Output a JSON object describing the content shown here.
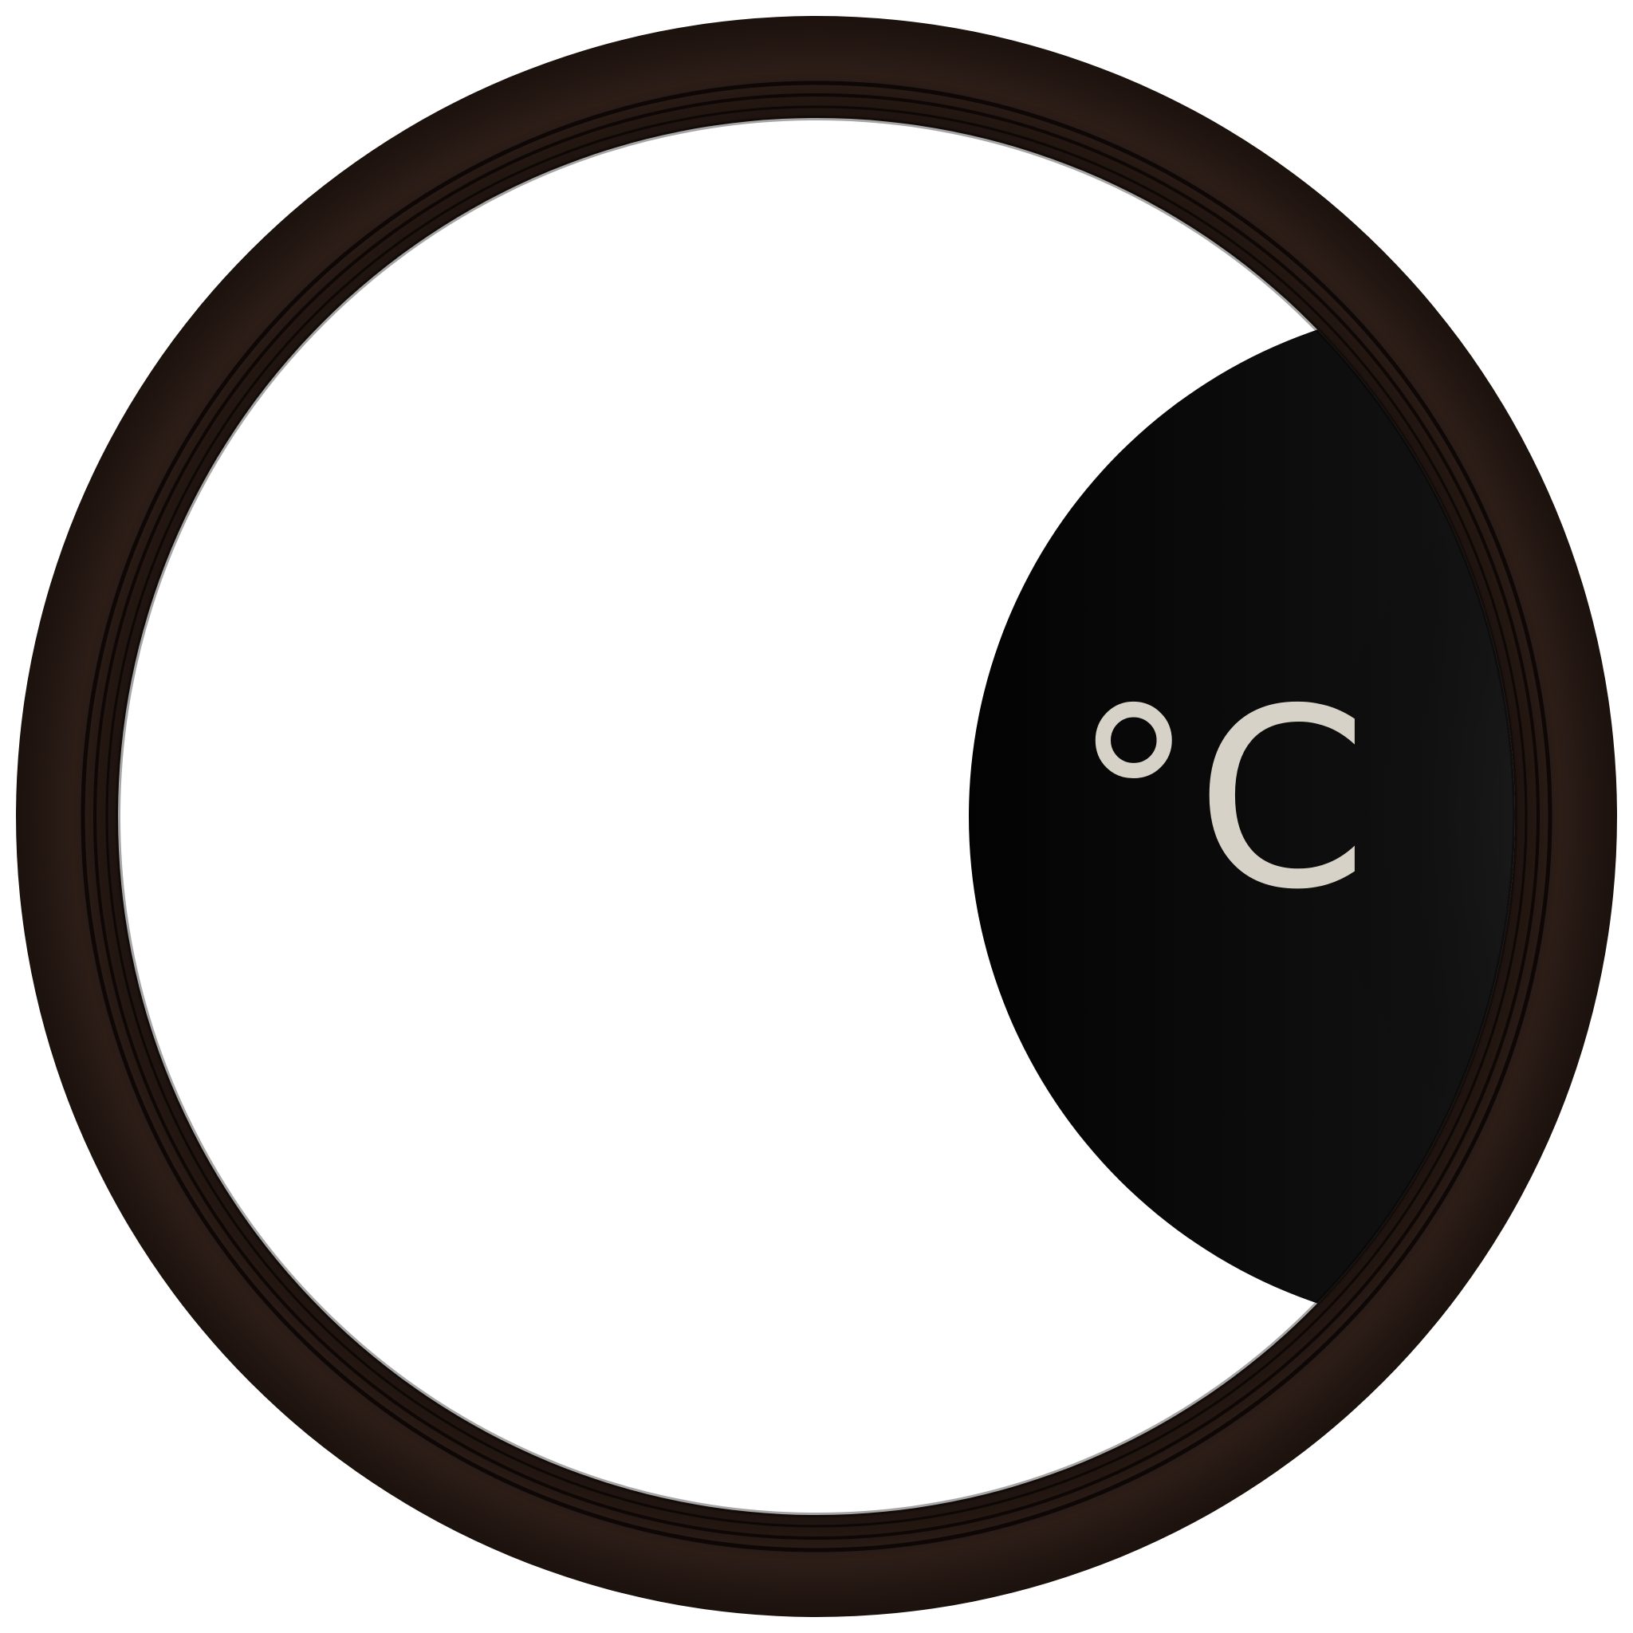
{
  "gauge": {
    "unit_label": "°C",
    "colors": {
      "background": "#ffffff",
      "bezel_outer": "#2a1c16",
      "bezel_inner": "#1f1410",
      "bezel_groove": "#120b08",
      "face": "#ffffff",
      "knob_dark": "#050505",
      "knob_mid": "#1a1a1a",
      "knob_light": "#2e2e2e",
      "unit_text": "#d6d2c8"
    },
    "icons": {
      "bezel": "round-bezel-icon",
      "knob": "unit-knob-icon"
    }
  }
}
